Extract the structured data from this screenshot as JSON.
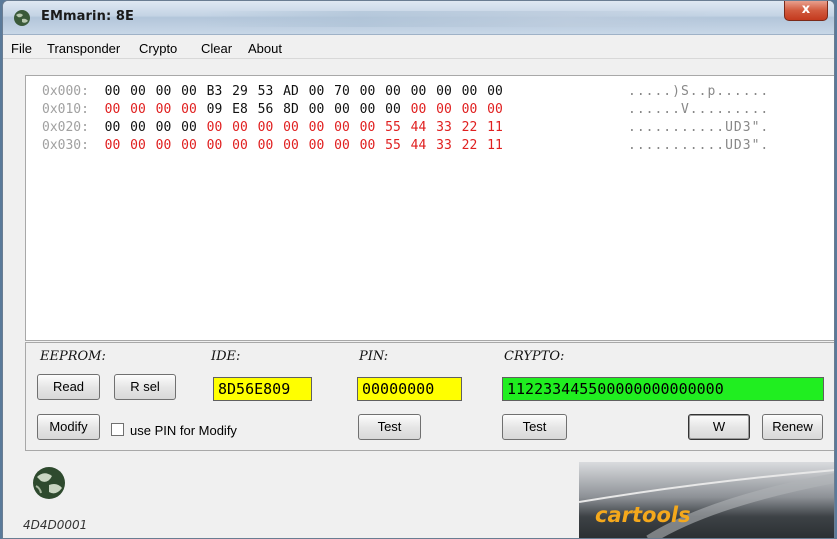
{
  "window": {
    "title": "EMmarin: 8E",
    "close_label": "x"
  },
  "menu": {
    "items": [
      "File",
      "Transponder",
      "Crypto",
      "Clear",
      "About"
    ]
  },
  "hex": {
    "rows": [
      {
        "addr": "0x000:",
        "bytes": [
          "00",
          "00",
          "00",
          "00",
          "B3",
          "29",
          "53",
          "AD",
          "00",
          "70",
          "00",
          "00",
          "00",
          "00",
          "00",
          "00"
        ],
        "red": [
          0,
          0,
          0,
          0,
          0,
          0,
          0,
          0,
          0,
          0,
          0,
          0,
          0,
          0,
          0,
          0
        ],
        "ascii": ".....)S..p......"
      },
      {
        "addr": "0x010:",
        "bytes": [
          "00",
          "00",
          "00",
          "00",
          "09",
          "E8",
          "56",
          "8D",
          "00",
          "00",
          "00",
          "00",
          "00",
          "00",
          "00",
          "00"
        ],
        "red": [
          1,
          1,
          1,
          1,
          0,
          0,
          0,
          0,
          0,
          0,
          0,
          0,
          1,
          1,
          1,
          1
        ],
        "ascii": "......V........."
      },
      {
        "addr": "0x020:",
        "bytes": [
          "00",
          "00",
          "00",
          "00",
          "00",
          "00",
          "00",
          "00",
          "00",
          "00",
          "00",
          "55",
          "44",
          "33",
          "22",
          "11"
        ],
        "red": [
          0,
          0,
          0,
          0,
          1,
          1,
          1,
          1,
          1,
          1,
          1,
          1,
          1,
          1,
          1,
          1
        ],
        "ascii": "...........UD3\"."
      },
      {
        "addr": "0x030:",
        "bytes": [
          "00",
          "00",
          "00",
          "00",
          "00",
          "00",
          "00",
          "00",
          "00",
          "00",
          "00",
          "55",
          "44",
          "33",
          "22",
          "11"
        ],
        "red": [
          1,
          1,
          1,
          1,
          1,
          1,
          1,
          1,
          1,
          1,
          1,
          1,
          1,
          1,
          1,
          1
        ],
        "ascii": "...........UD3\"."
      }
    ]
  },
  "panel": {
    "eeprom_label": "EEPROM:",
    "ide_label": "IDE:",
    "pin_label": "PIN:",
    "crypto_label": "CRYPTO:",
    "read_label": "Read",
    "rsel_label": "R sel",
    "ide_value": "8D56E809",
    "pin_value": "00000000",
    "crypto_value": "112233445500000000000000",
    "modify_label": "Modify",
    "use_pin_label": "use PIN for Modify",
    "use_pin_checked": false,
    "pin_test_label": "Test",
    "crypto_test_label": "Test",
    "w_label": "W",
    "renew_label": "Renew"
  },
  "footer": {
    "serial": "4D4D0001",
    "brand": "cartools"
  },
  "colors": {
    "red_byte": "#e02020",
    "field_yellow": "#ffff00",
    "field_green": "#20ee20",
    "brand_orange": "#f4a81c"
  },
  "icons": {
    "app": "globe-icon",
    "footer_logo": "globe-icon"
  }
}
